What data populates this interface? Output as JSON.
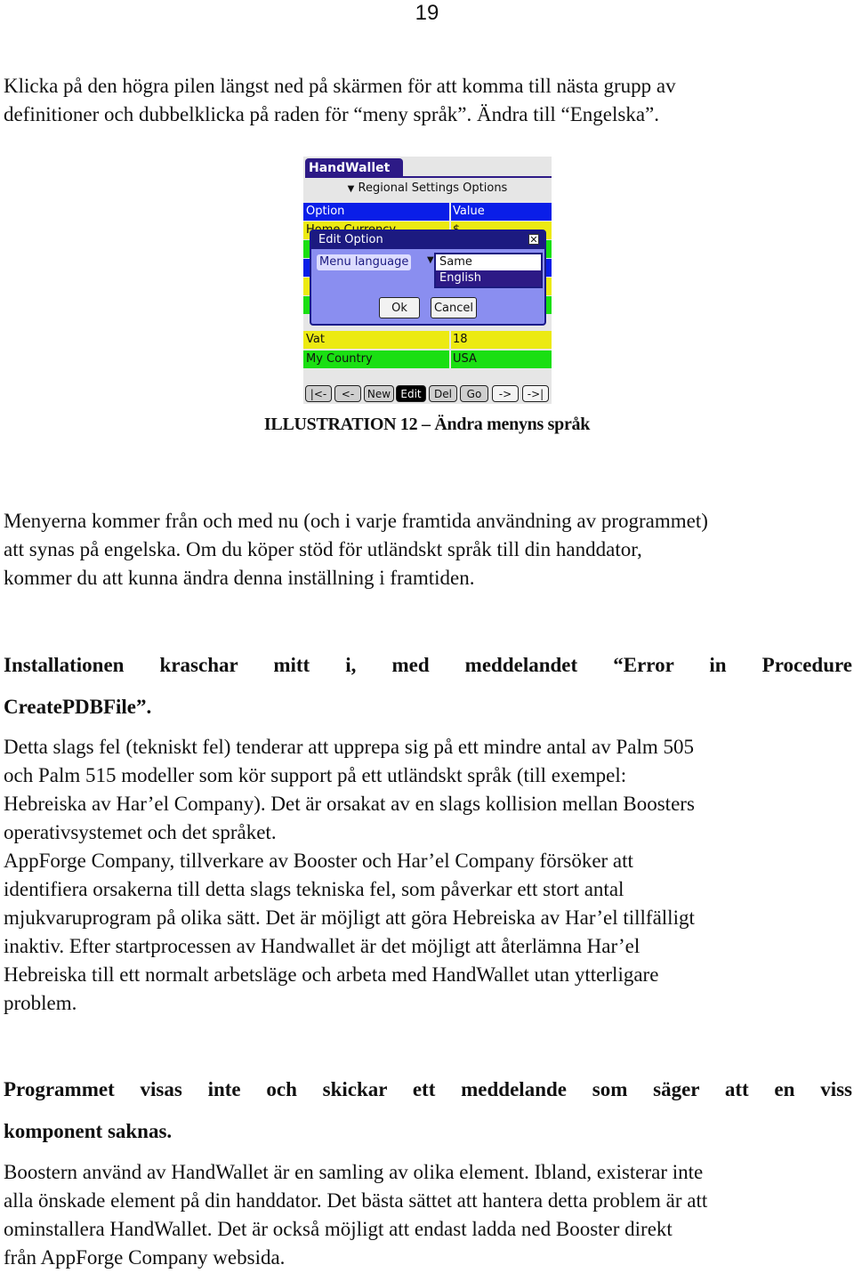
{
  "page_number": "19",
  "intro": {
    "lines": [
      "Klicka på den högra pilen längst ned på skärmen för att komma till nästa grupp av",
      "definitioner och dubbelklicka på raden för “meny språk”. Ändra till “Engelska”."
    ]
  },
  "screenshot": {
    "app_title": "HandWallet",
    "selector_arrow": "▼",
    "selector_label": "Regional Settings Options",
    "table_header": {
      "option": "Option",
      "value": "Value"
    },
    "rows": [
      {
        "option": "Home Currency",
        "value": "$",
        "color": "#ecea12"
      },
      {
        "option": "",
        "value": "",
        "color": "#1adf12"
      },
      {
        "option": "",
        "value": "",
        "color": "#0a1ee8"
      },
      {
        "option": "",
        "value": "",
        "color": "#ecea12"
      },
      {
        "option": "",
        "value": "",
        "color": "#1adf12"
      },
      {
        "option": "Vat",
        "value": "18",
        "color": "#ecea12"
      },
      {
        "option": "My Country",
        "value": "USA",
        "color": "#1adf12"
      }
    ],
    "dialog": {
      "title": "Edit Option",
      "close_glyph": "✕",
      "field_label": "Menu language",
      "dropdown_arrow": "▼",
      "options": [
        "Same",
        "English"
      ],
      "selected_option": "Same",
      "highlighted_option": "English",
      "ok_label": "Ok",
      "cancel_label": "Cancel"
    },
    "toolbar": [
      {
        "label": "|<-",
        "state": "normal"
      },
      {
        "label": "<-",
        "state": "normal"
      },
      {
        "label": "New",
        "state": "normal"
      },
      {
        "label": "Edit",
        "state": "active"
      },
      {
        "label": "Del",
        "state": "normal"
      },
      {
        "label": "Go",
        "state": "normal"
      },
      {
        "label": "->",
        "state": "light"
      },
      {
        "label": "->|",
        "state": "light"
      }
    ],
    "colors": {
      "title_bg": "#2d1a86",
      "header_blue": "#0a1ee8",
      "row_yellow": "#ecea12",
      "row_green": "#1adf12",
      "dialog_bg": "#8a8ef0"
    }
  },
  "caption": "ILLUSTRATION 12  – Ändra menyns språk",
  "para1": {
    "lines": [
      "Menyerna kommer från och med nu (och i varje framtida användning av programmet)",
      "att synas på engelska. Om du köper stöd för utländskt språk till din handdator,",
      "kommer du att kunna ändra denna inställning i framtiden."
    ]
  },
  "heading1": {
    "lines": [
      "Installationen kraschar mitt i, med meddelandet “Error in Procedure",
      "CreatePDBFile”."
    ]
  },
  "para2": {
    "lines": [
      "Detta slags fel (tekniskt fel) tenderar att upprepa sig på ett mindre antal av Palm 505",
      "och Palm 515 modeller som kör support på ett utländskt språk (till exempel:",
      "Hebreiska av Har’el Company). Det är orsakat av en slags kollision mellan Boosters",
      "operativsystemet och det språket.",
      "AppForge Company, tillverkare av Booster och Har’el Company försöker att",
      "identifiera orsakerna till detta slags tekniska fel, som påverkar ett stort antal",
      "mjukvaruprogram på olika sätt. Det är möjligt att göra Hebreiska av Har’el tillfälligt",
      "inaktiv. Efter startprocessen av Handwallet är det möjligt att återlämna Har’el",
      "Hebreiska till ett normalt arbetsläge och arbeta med HandWallet utan ytterligare",
      "problem."
    ]
  },
  "heading2": {
    "lines": [
      "Programmet visas inte och skickar ett meddelande som säger att en viss",
      "komponent saknas."
    ]
  },
  "para3": {
    "lines": [
      "Boostern använd av HandWallet är en samling av olika element. Ibland, existerar inte",
      "alla önskade element på din handdator. Det bästa sättet att hantera detta problem är att",
      "ominstallera HandWallet. Det är också möjligt att endast ladda ned Booster direkt",
      "från AppForge Company websida."
    ]
  }
}
